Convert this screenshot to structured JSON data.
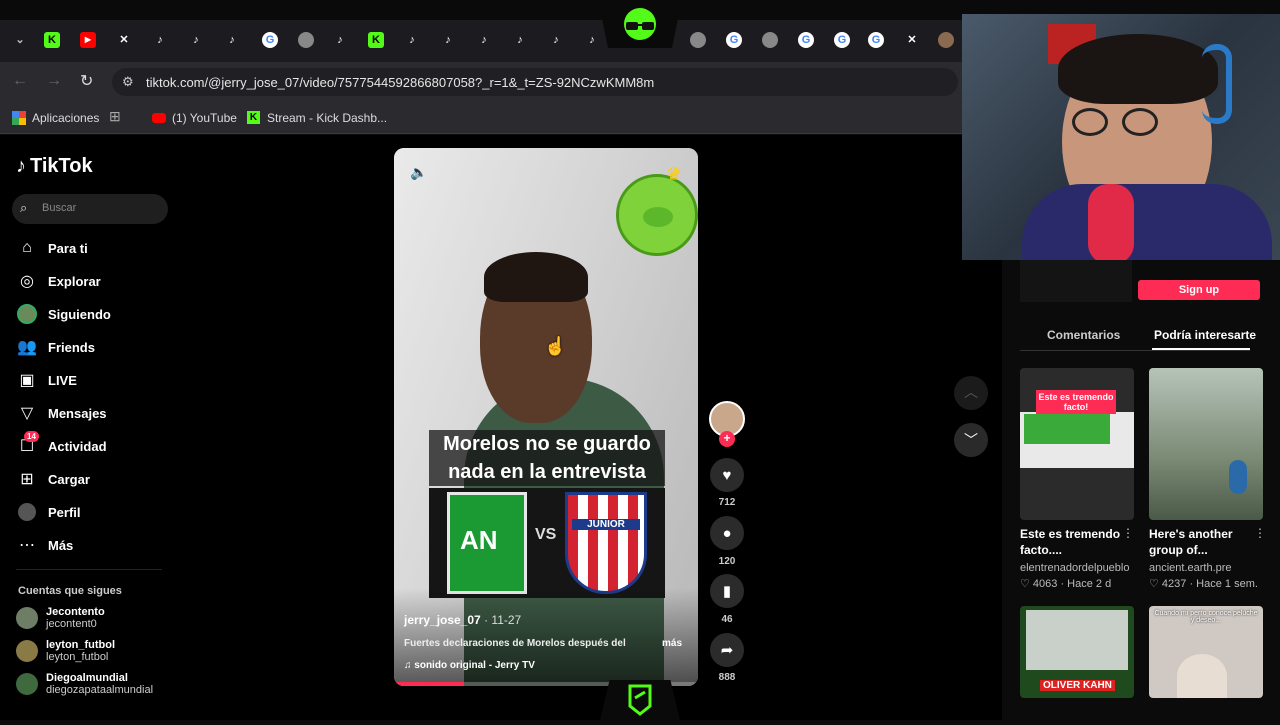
{
  "browser": {
    "url": "tiktok.com/@jerry_jose_07/video/7577544592866807058?_r=1&_t=ZS-92NCzwKMM8m",
    "bookmarks": [
      "Aplicaciones",
      "(1) YouTube",
      "Stream - Kick Dashb..."
    ]
  },
  "tiktok": {
    "logo": "TikTok",
    "search_placeholder": "Buscar",
    "nav": [
      "Para ti",
      "Explorar",
      "Siguiendo",
      "Friends",
      "LIVE",
      "Mensajes",
      "Actividad",
      "Cargar",
      "Perfil",
      "Más"
    ],
    "activity_badge": "14",
    "following_title": "Cuentas que sigues",
    "following": [
      {
        "name": "Jecontento",
        "handle": "jecontent0"
      },
      {
        "name": "leyton_futbol",
        "handle": "leyton_futbol"
      },
      {
        "name": "Diegoalmundial",
        "handle": "diegozapataalmundial"
      }
    ]
  },
  "video": {
    "caption_line1": "Morelos no se guardo",
    "caption_line2": "nada en la entrevista",
    "vs": "VS",
    "junior": "JUNIOR",
    "author": "jerry_jose_07",
    "date": "· 11-27",
    "description": "Fuertes declaraciones de Morelos después del",
    "more": "más",
    "sound": "sonido original - Jerry TV",
    "progress": 0.23
  },
  "actions": {
    "likes": "712",
    "comments": "120",
    "saves": "46",
    "shares": "888"
  },
  "right_panel": {
    "signup": "Sign up",
    "tabs": [
      "Comentarios",
      "Podría interesarte"
    ],
    "cards": [
      {
        "overlay": "Este es tremendo facto!",
        "title": "Este es tremendo facto....",
        "author": "elentrenadordelpueblo",
        "meta": "4063 · Hace 2 d"
      },
      {
        "title": "Here's another group of...",
        "author": "ancient.earth.pre",
        "meta": "4237 · Hace 1 sem."
      },
      {
        "overlay": "OLIVER KAHN"
      },
      {
        "overlay": "Cuando mi perro conoce peluche y deseo..."
      }
    ]
  },
  "colors": {
    "accent": "#fe2c55",
    "kick_green": "#53fc18",
    "bg": "#000000"
  }
}
